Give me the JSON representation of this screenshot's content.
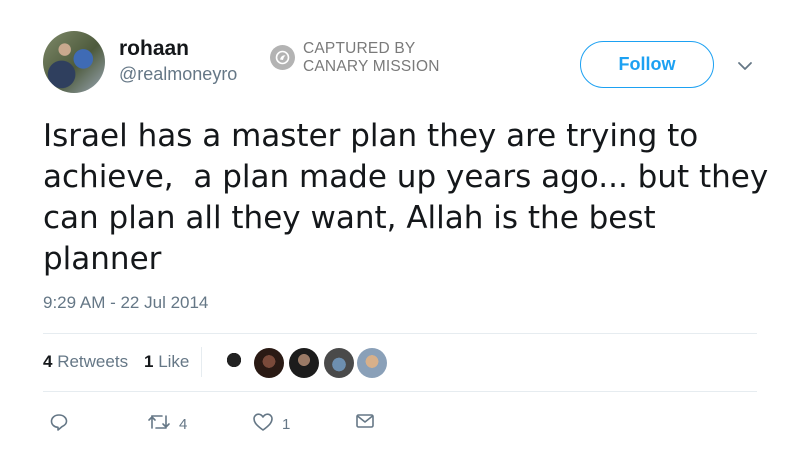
{
  "user": {
    "name": "rohaan",
    "handle": "@realmoneyro",
    "avatar_icon": "profile-photo"
  },
  "stamp": {
    "line1": "CAPTURED BY",
    "line2": "CANARY MISSION",
    "icon": "canary-logo-icon"
  },
  "follow_label": "Follow",
  "tweet": {
    "text": "Israel has a master plan they are trying to\nachieve,  a plan made up years ago... but they\ncan plan all they want, Allah is the best\nplanner",
    "timestamp": "9:29 AM - 22 Jul 2014"
  },
  "stats": {
    "retweets_count": "4",
    "retweets_label": "Retweets",
    "likes_count": "1",
    "likes_label": "Like"
  },
  "likers": [
    "liker-avatar-1",
    "liker-avatar-2",
    "liker-avatar-3",
    "liker-avatar-4",
    "liker-avatar-5"
  ],
  "actions": {
    "reply_count": "",
    "retweet_count": "4",
    "like_count": "1"
  },
  "colors": {
    "accent": "#1da1f2",
    "text": "#14171a",
    "secondary": "#657786",
    "divider": "#e6ecf0"
  }
}
